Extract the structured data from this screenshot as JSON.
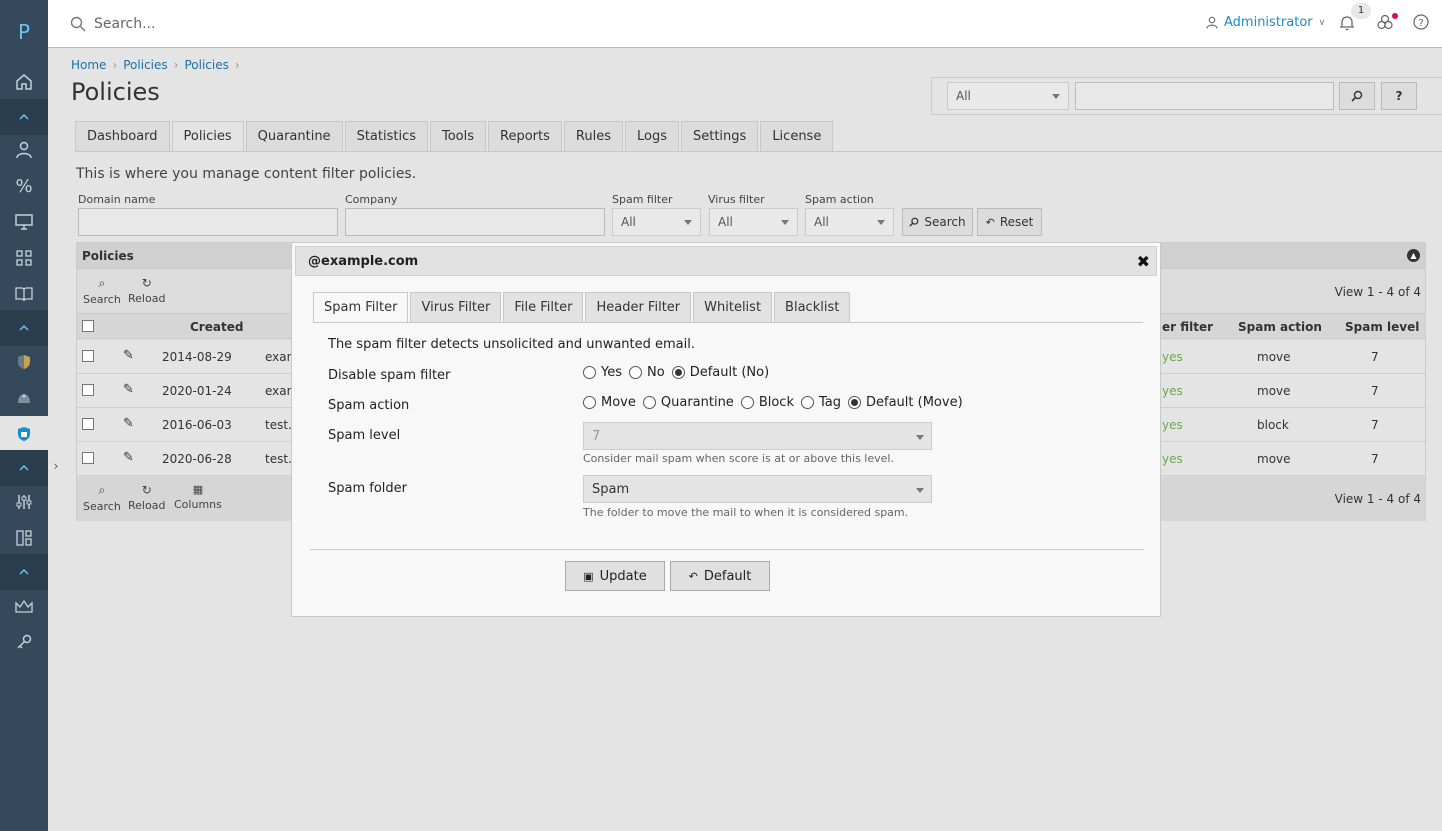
{
  "app": {
    "logo": "P"
  },
  "topbar": {
    "search_placeholder": "Search...",
    "user": "Administrator",
    "notification_count": "1"
  },
  "breadcrumb": [
    "Home",
    "Policies",
    "Policies"
  ],
  "page": {
    "title": "Policies",
    "description": "This is where you manage content filter policies."
  },
  "top_search": {
    "scope": "All",
    "query": "",
    "help_label": "?"
  },
  "tabs": [
    "Dashboard",
    "Policies",
    "Quarantine",
    "Statistics",
    "Tools",
    "Reports",
    "Rules",
    "Logs",
    "Settings",
    "License"
  ],
  "filters": {
    "domain_label": "Domain name",
    "company_label": "Company",
    "spam_filter_label": "Spam filter",
    "spam_filter_value": "All",
    "virus_filter_label": "Virus filter",
    "virus_filter_value": "All",
    "spam_action_label": "Spam action",
    "spam_action_value": "All",
    "search_button": "Search",
    "reset_button": "Reset"
  },
  "grid": {
    "title": "Policies",
    "toolbar": {
      "search": "Search",
      "reload": "Reload",
      "columns": "Columns"
    },
    "view_info": "View 1 - 4 of 4",
    "columns": {
      "created": "Created",
      "filter": "er filter",
      "spam_action": "Spam action",
      "spam_level": "Spam level"
    },
    "rows": [
      {
        "created": "2014-08-29",
        "name": "exan",
        "filter": "yes",
        "action": "move",
        "level": "7"
      },
      {
        "created": "2020-01-24",
        "name": "exan",
        "filter": "yes",
        "action": "move",
        "level": "7"
      },
      {
        "created": "2016-06-03",
        "name": "test.c",
        "filter": "yes",
        "action": "block",
        "level": "7"
      },
      {
        "created": "2020-06-28",
        "name": "test.c",
        "filter": "yes",
        "action": "move",
        "level": "7"
      }
    ]
  },
  "modal": {
    "title": "@example.com",
    "tabs": [
      "Spam Filter",
      "Virus Filter",
      "File Filter",
      "Header Filter",
      "Whitelist",
      "Blacklist"
    ],
    "description": "The spam filter detects unsolicited and unwanted email.",
    "disable_label": "Disable spam filter",
    "disable_options": [
      "Yes",
      "No",
      "Default (No)"
    ],
    "action_label": "Spam action",
    "action_options": [
      "Move",
      "Quarantine",
      "Block",
      "Tag",
      "Default (Move)"
    ],
    "level_label": "Spam level",
    "level_value": "7",
    "level_hint": "Consider mail spam when score is at or above this level.",
    "folder_label": "Spam folder",
    "folder_value": "Spam",
    "folder_hint": "The folder to move the mail to when it is considered spam.",
    "update_button": "Update",
    "default_button": "Default"
  },
  "colors": {
    "sidebar": "#344a5c",
    "accent": "#1a8cc9",
    "yes_green": "#6aa84f"
  }
}
